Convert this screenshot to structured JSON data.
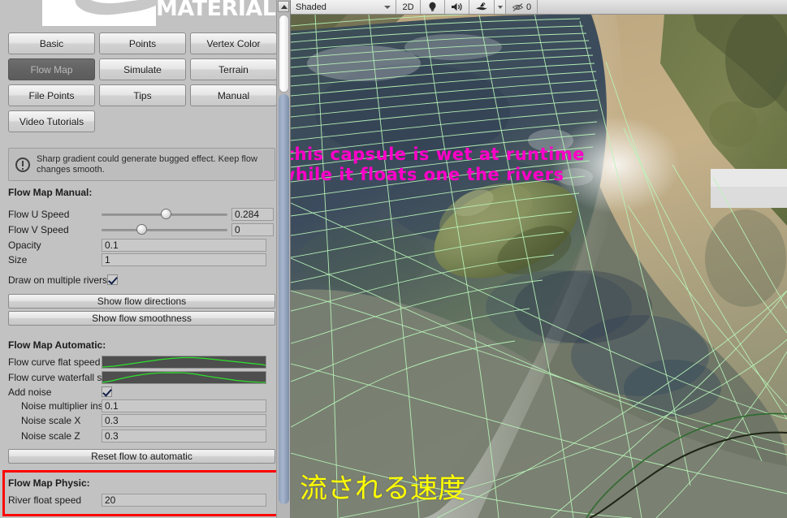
{
  "inspector": {
    "logo_text": "MATERIAL",
    "buttons": [
      {
        "label": "Basic",
        "active": false
      },
      {
        "label": "Points",
        "active": false
      },
      {
        "label": "Vertex Color",
        "active": false
      },
      {
        "label": "Flow Map",
        "active": true
      },
      {
        "label": "Simulate",
        "active": false
      },
      {
        "label": "Terrain",
        "active": false
      },
      {
        "label": "File Points",
        "active": false
      },
      {
        "label": "Tips",
        "active": false
      },
      {
        "label": "Manual",
        "active": false
      },
      {
        "label": "Video Tutorials",
        "active": false
      }
    ],
    "helpbox": {
      "icon": "warning-icon",
      "text": "Sharp gradient could generate bugged effect. Keep flow changes smooth."
    },
    "manual_section": {
      "heading": "Flow Map Manual:",
      "rows": [
        {
          "label": "Flow U Speed",
          "value": "0.284",
          "kind": "slider",
          "knob_pct": 47
        },
        {
          "label": "Flow V Speed",
          "value": "0",
          "kind": "slider",
          "knob_pct": 28
        },
        {
          "label": "Opacity",
          "value": "0.1",
          "kind": "field"
        },
        {
          "label": "Size",
          "value": "1",
          "kind": "field"
        }
      ],
      "checkbox": {
        "label": "Draw on multiple rivers",
        "checked": true
      }
    },
    "action_buttons": [
      {
        "label": "Show flow directions"
      },
      {
        "label": "Show flow smoothness"
      }
    ],
    "automatic_section": {
      "heading": "Flow Map Automatic:",
      "curves": [
        {
          "label": "Flow curve flat speed",
          "curve_name": "flat-speed-curve"
        },
        {
          "label": "Flow curve waterfall speed",
          "curve_name": "waterfall-speed-curve"
        }
      ],
      "checkbox": {
        "label": "Add noise",
        "checked": true
      },
      "rows": [
        {
          "label": "Noise multiplier inside",
          "value": "0.1"
        },
        {
          "label": "Noise scale X",
          "value": "0.3"
        },
        {
          "label": "Noise scale Z",
          "value": "0.3"
        }
      ]
    },
    "reset_button": {
      "label": "Reset flow to automatic"
    },
    "physic_section": {
      "heading": "Flow Map Physic:",
      "rows": [
        {
          "label": "River float speed",
          "value": "20"
        }
      ],
      "highlight_color": "#ff0000"
    }
  },
  "scene": {
    "toolbar": {
      "shading_mode": "Shaded",
      "two_d_toggle": "2D",
      "lighting_icon": "light-bulb-icon",
      "audio_icon": "speaker-icon",
      "fx_icon": "effects-icon",
      "fx_caret_icon": "chevron-down-icon",
      "hidden_icon": "eye-off-icon",
      "hidden_count": "0"
    },
    "overlay_texts": [
      {
        "text": "this capsule is wet at runtime",
        "name": "capsule-note-line1",
        "color": "#ff00c8"
      },
      {
        "text": "while it floats one the rivers",
        "name": "capsule-note-line2",
        "color": "#ff00c8"
      }
    ],
    "annotation_jp": {
      "text": "流される速度",
      "name": "speed-annotation",
      "color": "#ffff00"
    },
    "objects": {
      "rock_name": "river-rock-mesh",
      "box_name": "white-box-mesh",
      "river_gizmo_name": "river-flow-gizmo"
    }
  }
}
